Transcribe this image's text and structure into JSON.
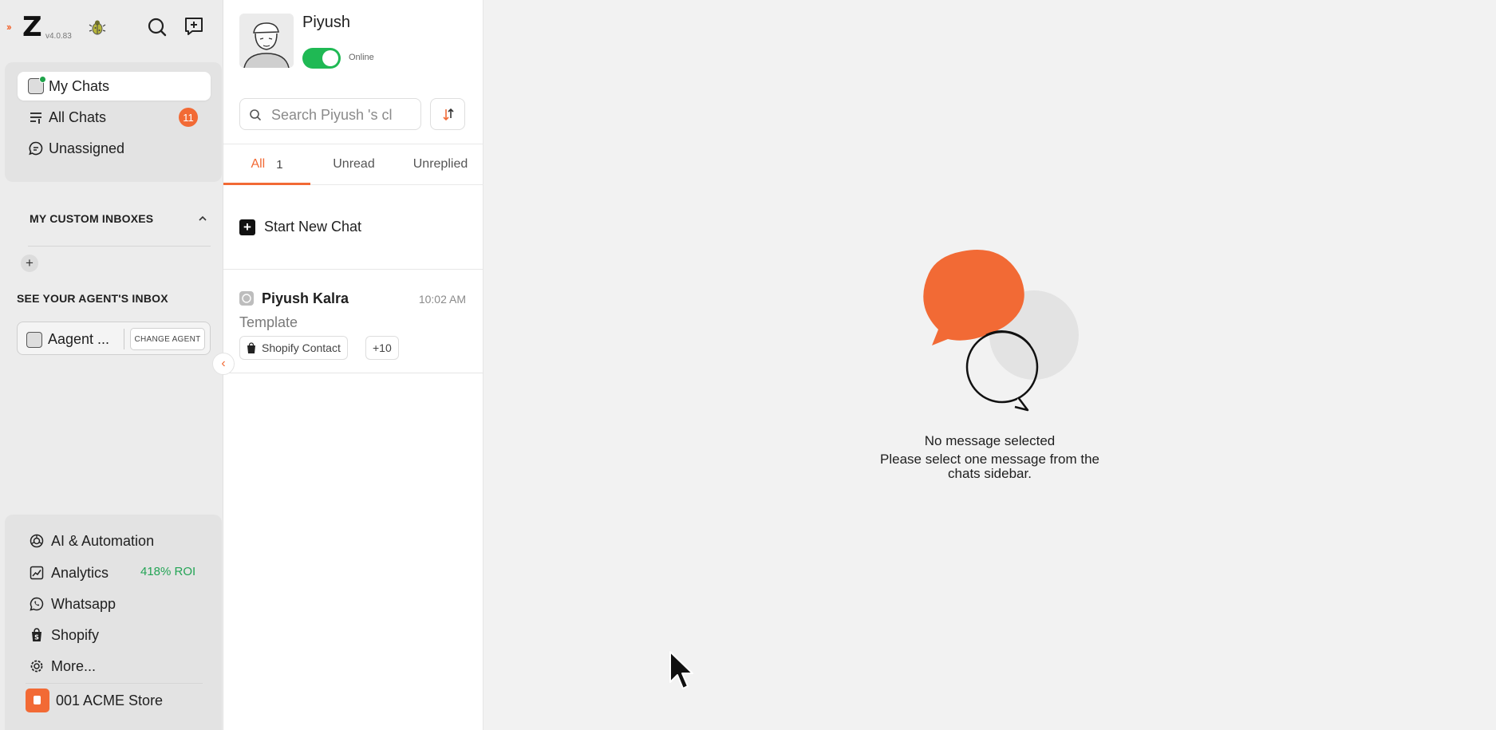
{
  "app": {
    "version": "v4.0.83"
  },
  "sidebar": {
    "nav": [
      {
        "label": "My Chats",
        "active": true
      },
      {
        "label": "All Chats",
        "badge": "11"
      },
      {
        "label": "Unassigned"
      }
    ],
    "custom_inboxes_title": "MY CUSTOM INBOXES",
    "agent_inbox_title": "SEE YOUR AGENT'S INBOX",
    "agent_name": "Aagent ...",
    "change_agent_label": "CHANGE AGENT",
    "tools": [
      {
        "label": "AI & Automation",
        "icon": "openai-icon"
      },
      {
        "label": "Analytics",
        "icon": "chart-icon",
        "extra": "418% ROI"
      },
      {
        "label": "Whatsapp",
        "icon": "whatsapp-icon"
      },
      {
        "label": "Shopify",
        "icon": "shopify-icon"
      },
      {
        "label": "More...",
        "icon": "gear-icon"
      }
    ],
    "store_name": "001 ACME Store"
  },
  "chat_list": {
    "profile_name": "Piyush",
    "status_label": "Online",
    "search_placeholder": "Search Piyush 's cl",
    "tabs": [
      {
        "label": "All",
        "count": "1",
        "active": true
      },
      {
        "label": "Unread"
      },
      {
        "label": "Unreplied"
      }
    ],
    "new_chat_label": "Start New Chat",
    "chats": [
      {
        "name": "Piyush Kalra",
        "time": "10:02 AM",
        "preview": "Template",
        "tags": [
          "Shopify Contact",
          "+10"
        ]
      }
    ]
  },
  "main": {
    "empty_title": "No message selected",
    "empty_desc_line1": "Please select one message from the",
    "empty_desc_line2": "chats sidebar."
  },
  "colors": {
    "accent": "#f26a35",
    "online": "#1fb954",
    "roi": "#23a455"
  }
}
